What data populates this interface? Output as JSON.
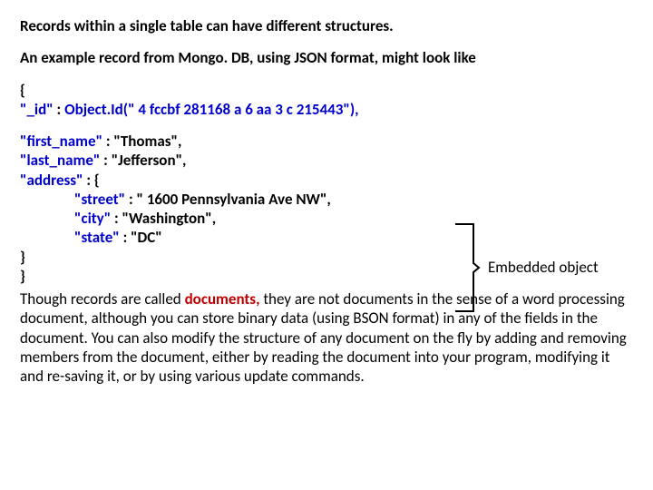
{
  "heading": "Records within a single table can have different structures.",
  "intro": "An example record from Mongo. DB, using JSON format, might look like",
  "code": {
    "open_brace": "{",
    "id_line_key": "\"_id\" ",
    "id_line_colon": ": ",
    "id_line_val": "Object.Id(\" 4 fccbf 281168 a 6 aa 3 c 215443\"),",
    "first_name_key": "\"first_name\" ",
    "first_name_val": ": \"Thomas\",",
    "last_name_key": "\"last_name\" ",
    "last_name_val": ": \"Jefferson\",",
    "address_key": "\"address\" ",
    "address_val": ": {",
    "street_key": "\"street\" ",
    "street_val": ": \" 1600 Pennsylvania Ave NW\",",
    "city_key": "\"city\" ",
    "city_val": ": \"Washington\",",
    "state_key": "\"state\" ",
    "state_val": ": \"DC\"",
    "close1": "}",
    "close2": "}"
  },
  "annotation": "Embedded object",
  "footer_pre": "Though records are called ",
  "footer_em": "documents, ",
  "footer_post": "they are not documents in the sense of a word processing document, although you can store binary data (using BSON format) in any of the fields in the document. You can also modify the structure of any document on the fly by adding and removing members from the document, either by reading the document into your program, modifying it and re-saving it, or by using various update commands."
}
